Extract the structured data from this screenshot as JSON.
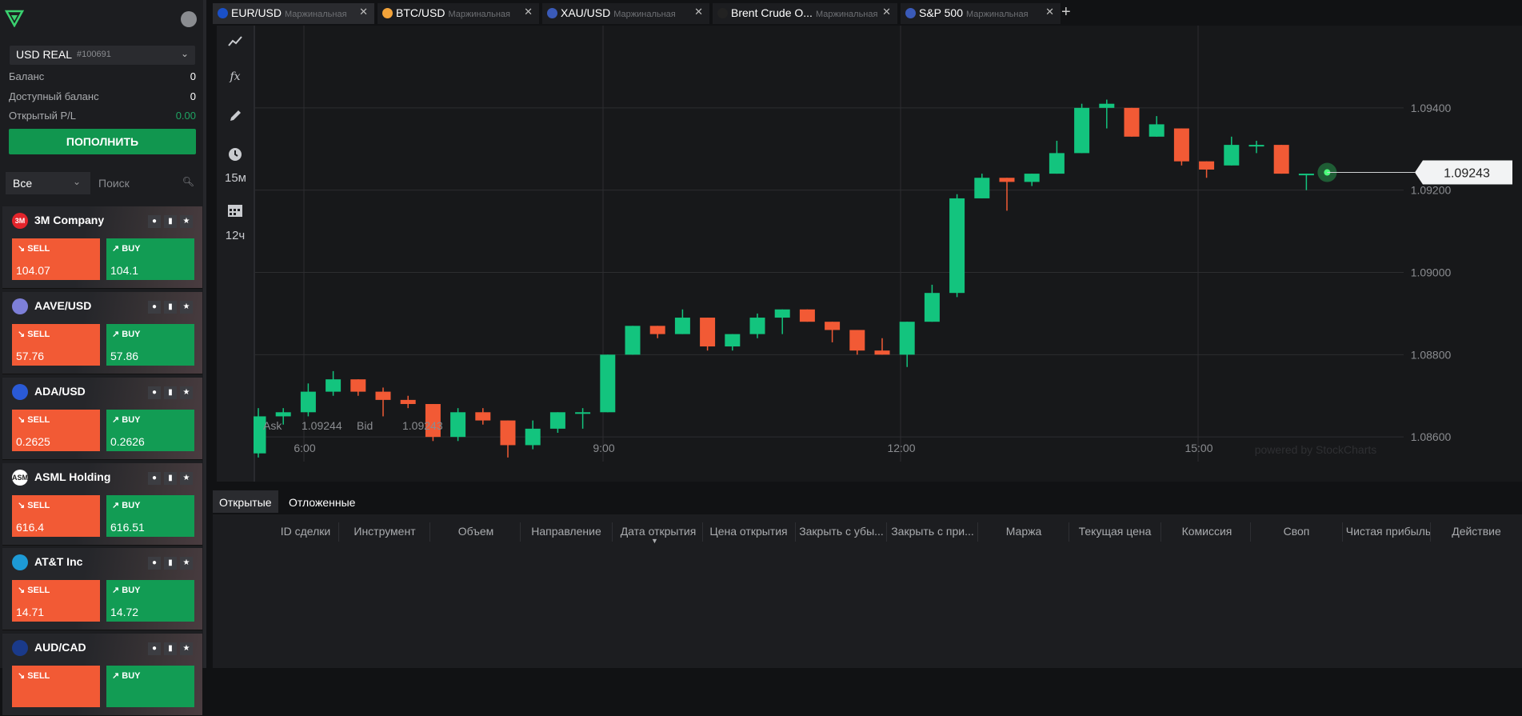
{
  "sidebar": {
    "account": {
      "currency": "USD  REAL",
      "number": "#100691"
    },
    "balance": {
      "label": "Баланс",
      "value": "0"
    },
    "available": {
      "label": "Доступный баланс",
      "value": "0"
    },
    "open_pl": {
      "label": "Открытый P/L",
      "value": "0.00"
    },
    "deposit_label": "ПОПОЛНИТЬ",
    "filter_value": "Все",
    "search_placeholder": "Поиск",
    "instruments": [
      {
        "name": "3M Company",
        "sell_label": "SELL",
        "sell": "104.07",
        "buy_label": "BUY",
        "buy": "104.1",
        "logo": "3M",
        "logo_color": "#e3242b"
      },
      {
        "name": "AAVE/USD",
        "sell_label": "SELL",
        "sell": "57.76",
        "buy_label": "BUY",
        "buy": "57.86",
        "logo": "",
        "logo_color": "#7d7fd8"
      },
      {
        "name": "ADA/USD",
        "sell_label": "SELL",
        "sell": "0.2625",
        "buy_label": "BUY",
        "buy": "0.2626",
        "logo": "",
        "logo_color": "#2a5ad6"
      },
      {
        "name": "ASML Holding",
        "sell_label": "SELL",
        "sell": "616.4",
        "buy_label": "BUY",
        "buy": "616.51",
        "logo": "ASML",
        "logo_color": "#ffffff"
      },
      {
        "name": "AT&T Inc",
        "sell_label": "SELL",
        "sell": "14.71",
        "buy_label": "BUY",
        "buy": "14.72",
        "logo": "",
        "logo_color": "#1d9ad6"
      },
      {
        "name": "AUD/CAD",
        "sell_label": "SELL",
        "sell": "",
        "buy_label": "BUY",
        "buy": "",
        "logo": "",
        "logo_color": "#1a3a8a"
      }
    ]
  },
  "tabs": [
    {
      "name": "EUR/USD",
      "sub": "Маржинальная",
      "active": true,
      "icon_color": "#1a50c8"
    },
    {
      "name": "BTC/USD",
      "sub": "Маржинальная",
      "active": false,
      "icon_color": "#f2a33a"
    },
    {
      "name": "XAU/USD",
      "sub": "Маржинальная",
      "active": false,
      "icon_color": "#3a5ab8"
    },
    {
      "name": "Brent Crude O...",
      "sub": "Маржинальная",
      "active": false,
      "icon_color": "#222222"
    },
    {
      "name": "S&P 500",
      "sub": "Маржинальная",
      "active": false,
      "icon_color": "#3a5ab8"
    }
  ],
  "toolbar": {
    "timeframe1": "15м",
    "timeframe2": "12ч"
  },
  "chart_data": {
    "type": "candlestick",
    "x_ticks": [
      "6:00",
      "9:00",
      "12:00",
      "15:00"
    ],
    "y_ticks": [
      "1.08600",
      "1.08800",
      "1.09000",
      "1.09200",
      "1.09400"
    ],
    "ylim": [
      1.0854,
      1.096
    ],
    "current_price": "1.09243",
    "ask_label": "Ask",
    "ask": "1.09244",
    "bid_label": "Bid",
    "bid": "1.09243",
    "watermark": "powered by StockCharts",
    "up_color": "#13c47e",
    "down_color": "#f25a35",
    "candles": [
      {
        "o": 1.0856,
        "c": 1.0865,
        "h": 1.0867,
        "l": 1.0855
      },
      {
        "o": 1.0865,
        "c": 1.0866,
        "h": 1.0867,
        "l": 1.0863
      },
      {
        "o": 1.0866,
        "c": 1.0871,
        "h": 1.0873,
        "l": 1.0865
      },
      {
        "o": 1.0871,
        "c": 1.0874,
        "h": 1.0876,
        "l": 1.087
      },
      {
        "o": 1.0874,
        "c": 1.0871,
        "h": 1.0874,
        "l": 1.087
      },
      {
        "o": 1.0871,
        "c": 1.0869,
        "h": 1.0872,
        "l": 1.0865
      },
      {
        "o": 1.0869,
        "c": 1.0868,
        "h": 1.087,
        "l": 1.0867
      },
      {
        "o": 1.0868,
        "c": 1.086,
        "h": 1.0868,
        "l": 1.0859
      },
      {
        "o": 1.086,
        "c": 1.0866,
        "h": 1.0867,
        "l": 1.0859
      },
      {
        "o": 1.0866,
        "c": 1.0864,
        "h": 1.0867,
        "l": 1.0863
      },
      {
        "o": 1.0864,
        "c": 1.0858,
        "h": 1.0864,
        "l": 1.0855
      },
      {
        "o": 1.0858,
        "c": 1.0862,
        "h": 1.0864,
        "l": 1.0857
      },
      {
        "o": 1.0862,
        "c": 1.0866,
        "h": 1.0866,
        "l": 1.0861
      },
      {
        "o": 1.0866,
        "c": 1.0866,
        "h": 1.0867,
        "l": 1.0862
      },
      {
        "o": 1.0866,
        "c": 1.088,
        "h": 1.088,
        "l": 1.0866
      },
      {
        "o": 1.088,
        "c": 1.0887,
        "h": 1.0887,
        "l": 1.088
      },
      {
        "o": 1.0887,
        "c": 1.0885,
        "h": 1.0887,
        "l": 1.0884
      },
      {
        "o": 1.0885,
        "c": 1.0889,
        "h": 1.0891,
        "l": 1.0885
      },
      {
        "o": 1.0889,
        "c": 1.0882,
        "h": 1.0889,
        "l": 1.0881
      },
      {
        "o": 1.0882,
        "c": 1.0885,
        "h": 1.0885,
        "l": 1.0881
      },
      {
        "o": 1.0885,
        "c": 1.0889,
        "h": 1.089,
        "l": 1.0884
      },
      {
        "o": 1.0889,
        "c": 1.0891,
        "h": 1.0891,
        "l": 1.0885
      },
      {
        "o": 1.0891,
        "c": 1.0888,
        "h": 1.0891,
        "l": 1.0888
      },
      {
        "o": 1.0888,
        "c": 1.0886,
        "h": 1.0888,
        "l": 1.0883
      },
      {
        "o": 1.0886,
        "c": 1.0881,
        "h": 1.0886,
        "l": 1.088
      },
      {
        "o": 1.0881,
        "c": 1.088,
        "h": 1.0884,
        "l": 1.088
      },
      {
        "o": 1.088,
        "c": 1.0888,
        "h": 1.0888,
        "l": 1.0877
      },
      {
        "o": 1.0888,
        "c": 1.0895,
        "h": 1.0897,
        "l": 1.0888
      },
      {
        "o": 1.0895,
        "c": 1.0918,
        "h": 1.0919,
        "l": 1.0894
      },
      {
        "o": 1.0918,
        "c": 1.0923,
        "h": 1.0924,
        "l": 1.0918
      },
      {
        "o": 1.0923,
        "c": 1.0922,
        "h": 1.0923,
        "l": 1.0915
      },
      {
        "o": 1.0922,
        "c": 1.0924,
        "h": 1.0924,
        "l": 1.0921
      },
      {
        "o": 1.0924,
        "c": 1.0929,
        "h": 1.0932,
        "l": 1.0924
      },
      {
        "o": 1.0929,
        "c": 1.094,
        "h": 1.0941,
        "l": 1.0929
      },
      {
        "o": 1.094,
        "c": 1.0941,
        "h": 1.0942,
        "l": 1.0935
      },
      {
        "o": 1.094,
        "c": 1.0933,
        "h": 1.094,
        "l": 1.0933
      },
      {
        "o": 1.0933,
        "c": 1.0936,
        "h": 1.0938,
        "l": 1.0933
      },
      {
        "o": 1.0935,
        "c": 1.0927,
        "h": 1.0935,
        "l": 1.0926
      },
      {
        "o": 1.0927,
        "c": 1.0925,
        "h": 1.0927,
        "l": 1.0923
      },
      {
        "o": 1.0926,
        "c": 1.0931,
        "h": 1.0933,
        "l": 1.0926
      },
      {
        "o": 1.0931,
        "c": 1.0931,
        "h": 1.0932,
        "l": 1.0929
      },
      {
        "o": 1.0931,
        "c": 1.0924,
        "h": 1.0931,
        "l": 1.0924
      },
      {
        "o": 1.0924,
        "c": 1.0924,
        "h": 1.0924,
        "l": 1.092
      }
    ]
  },
  "bottom": {
    "tabs": [
      "Открытые",
      "Отложенные"
    ],
    "columns": [
      "ID сделки",
      "Инструмент",
      "Объем",
      "Направление",
      "Дата открытия",
      "Цена открытия",
      "Закрыть с убы...",
      "Закрыть с при...",
      "Маржа",
      "Текущая цена",
      "Комиссия",
      "Своп",
      "Чистая прибыль",
      "Действие"
    ]
  }
}
